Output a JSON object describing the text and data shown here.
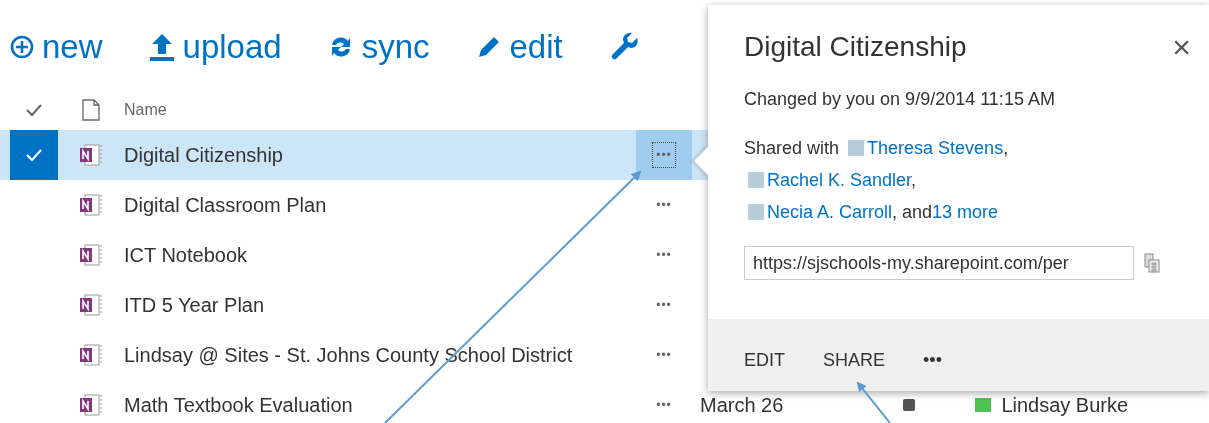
{
  "toolbar": [
    {
      "kind": "new",
      "label": "new"
    },
    {
      "kind": "upload",
      "label": "upload"
    },
    {
      "kind": "sync",
      "label": "sync"
    },
    {
      "kind": "edit",
      "label": "edit"
    },
    {
      "kind": "wrench"
    }
  ],
  "table": {
    "columns": [
      "Name"
    ],
    "rows": [
      {
        "name": "Digital Citizenship",
        "selected": true,
        "menu": "•••"
      },
      {
        "name": "Digital Classroom Plan",
        "selected": false,
        "menu": "•••"
      },
      {
        "name": "ICT Notebook",
        "selected": false,
        "menu": "•••"
      },
      {
        "name": "ITD 5 Year Plan",
        "selected": false,
        "menu": "•••"
      },
      {
        "name": "Lindsay @ Sites - St. Johns County School District",
        "selected": false,
        "menu": "•••"
      },
      {
        "name": "Math Textbook Evaluation",
        "selected": false,
        "menu": "•••",
        "column_3": "March 26",
        "shared": true,
        "column_5": "Lindsay Burke",
        "color": "#4fc34f"
      }
    ]
  },
  "callout": {
    "title": "Digital Citizenship",
    "close": "×",
    "changed": "Changed by you on 9/9/2014 11:15 AM",
    "shared_label": "Shared with",
    "people": [
      {
        "name": "Theresa Stevens",
        "after": ","
      },
      {
        "name": "Rachel K. Sandler",
        "after": ","
      },
      {
        "name": "Necia A. Carroll",
        "after": ", and"
      }
    ],
    "more": "13 more",
    "link": "https://sjschools-my.sharepoint.com/per",
    "actions": [
      "EDIT",
      "SHARE",
      "•••"
    ]
  }
}
